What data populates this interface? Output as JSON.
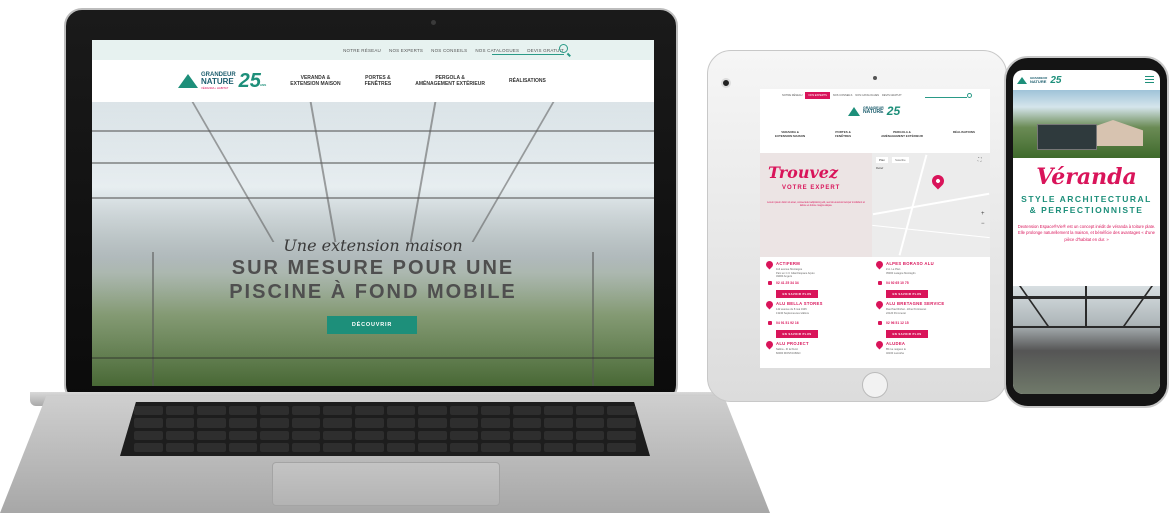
{
  "laptop": {
    "top_nav": [
      "NOTRE RÉSEAU",
      "NOS EXPERTS",
      "NOS CONSEILS",
      "NOS CATALOGUES",
      "DEVIS GRATUIT"
    ],
    "logo": {
      "line1": "GRANDEUR",
      "line2": "NATURE",
      "tagline": "VÉRANDA • HABITAT",
      "anniversary": "25",
      "anniversary_suffix": "ANS"
    },
    "menu": [
      "VERANDA &\nEXTENSION MAISON",
      "PORTES &\nFENÊTRES",
      "PERGOLA &\nAMÉNAGEMENT EXTÉRIEUR",
      "RÉALISATIONS"
    ],
    "hero": {
      "script": "Une extension maison",
      "title_line1": "SUR MESURE POUR UNE",
      "title_line2": "PISCINE À FOND MOBILE",
      "cta": "DÉCOUVRIR"
    }
  },
  "tablet": {
    "top_nav": [
      "NOTRE RÉSEAU",
      "NOS EXPERTS",
      "NOS CONSEILS",
      "NOS CATALOGUES",
      "DEVIS GRATUIT"
    ],
    "active_nav": "NOS EXPERTS",
    "menu": [
      "VERANDA &\nEXTENSION MAISON",
      "PORTES &\nFENÊTRES",
      "PERGOLA &\nAMÉNAGEMENT EXTÉRIEUR",
      "RÉALISATIONS"
    ],
    "banner": {
      "script": "Trouvez",
      "subtitle": "VOTRE EXPERT",
      "body": "Lorem ipsum dolor sit amet, consectetur adipisicing elit, sed do eiusmod tempor incididunt ut labore et dolore magna aliqua."
    },
    "map": {
      "tab_plan": "Plan",
      "tab_satellite": "Satellite",
      "relief": "Relief"
    },
    "dealers": [
      {
        "name": "ACTIFERM",
        "addr": "114 avenue Montaigne\nParc en C.C Gilard Espace Arpéo\n49000 Angers",
        "phone": "02 41 25 34 34",
        "cta": "EN SAVOIR PLUS"
      },
      {
        "name": "ALPES BORASO ALU",
        "addr": "Z.A. Le Plan\n05300 Laragne Montéglin",
        "phone": "04 92 65 10 75",
        "cta": "EN SAVOIR PLUS"
      },
      {
        "name": "ALU BELLA STORES",
        "addr": "142 avenue du 8 mai 1945\n13240 Septèmes-les-Vallons",
        "phone": "04 91 51 92 16",
        "cta": "EN SAVOIR PLUS"
      },
      {
        "name": "ALU BRETAGNE SERVICE",
        "addr": "Rue Paul Richet - Zône Pontmenet\n22120 Pommeret",
        "phone": "02 96 51 12 15",
        "cta": "EN SAVOIR PLUS"
      },
      {
        "name": "ALU PROJECT",
        "addr": "Nafina - ZI la Pecci\n82000 MONTAUBAN",
        "phone": "",
        "cta": ""
      },
      {
        "name": "ALUDEA",
        "addr": "85 rue neigeux le\n40160 Lamothe",
        "phone": "",
        "cta": ""
      }
    ]
  },
  "phone": {
    "script": "Véranda",
    "style": "STYLE ARCHITECTURAL\n& PERFECTIONNISTE",
    "description": "Dextension Espace®Vie® est un concept inédit de véranda à toiture plate. Elle prolonge naturellement la maison, et bénéficie des avantages « d'une pièce d'habitat en dur. »"
  },
  "colors": {
    "teal": "#1d8f7a",
    "pink": "#d9145a",
    "navy": "#1d5e6e"
  }
}
